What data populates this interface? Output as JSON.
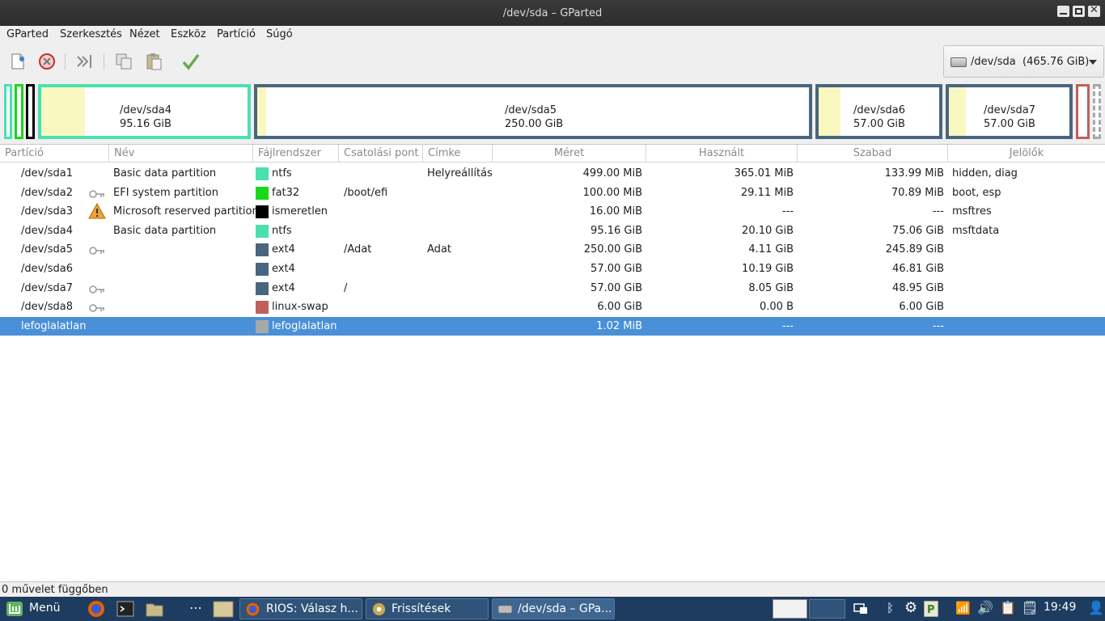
{
  "window": {
    "title": "/dev/sda – GParted"
  },
  "menu": [
    "GParted",
    "Szerkesztés",
    "Nézet",
    "Eszköz",
    "Partíció",
    "Súgó"
  ],
  "toolbar": {
    "icons": [
      "new-partition-icon",
      "delete-icon",
      "resize-move-icon",
      "copy-icon",
      "paste-icon",
      "apply-icon"
    ]
  },
  "device": {
    "name": "/dev/sda",
    "size": "(465.76 GiB)"
  },
  "map": [
    {
      "name": "/dev/sda4",
      "size": "95.16 GiB",
      "color": "#4ae0b0",
      "used": 0.21
    },
    {
      "name": "/dev/sda5",
      "size": "250.00 GiB",
      "color": "#4a6580",
      "used": 0.016
    },
    {
      "name": "/dev/sda6",
      "size": "57.00 GiB",
      "color": "#4a6580",
      "used": 0.18
    },
    {
      "name": "/dev/sda7",
      "size": "57.00 GiB",
      "color": "#4a6580",
      "used": 0.14
    }
  ],
  "columns": [
    "Partíció",
    "Név",
    "Fájlrendszer",
    "Csatolási pont",
    "Címke",
    "Méret",
    "Használt",
    "Szabad",
    "Jelölők"
  ],
  "rows": [
    {
      "partition": "/dev/sda1",
      "name": "Basic data partition",
      "fs": "ntfs",
      "fs_color": "#4ae0b0",
      "mount": "",
      "label": "Helyreállítás",
      "size": "499.00 MiB",
      "used": "365.01 MiB",
      "free": "133.99 MiB",
      "flags": "hidden, diag",
      "icon": ""
    },
    {
      "partition": "/dev/sda2",
      "name": "EFI system partition",
      "fs": "fat32",
      "fs_color": "#18d818",
      "mount": "/boot/efi",
      "label": "",
      "size": "100.00 MiB",
      "used": "29.11 MiB",
      "free": "70.89 MiB",
      "flags": "boot, esp",
      "icon": "key"
    },
    {
      "partition": "/dev/sda3",
      "name": "Microsoft reserved partition",
      "fs": "ismeretlen",
      "fs_color": "#000000",
      "mount": "",
      "label": "",
      "size": "16.00 MiB",
      "used": "---",
      "free": "---",
      "flags": "msftres",
      "icon": "warning"
    },
    {
      "partition": "/dev/sda4",
      "name": "Basic data partition",
      "fs": "ntfs",
      "fs_color": "#4ae0b0",
      "mount": "",
      "label": "",
      "size": "95.16 GiB",
      "used": "20.10 GiB",
      "free": "75.06 GiB",
      "flags": "msftdata",
      "icon": ""
    },
    {
      "partition": "/dev/sda5",
      "name": "",
      "fs": "ext4",
      "fs_color": "#4a6580",
      "mount": "/Adat",
      "label": "Adat",
      "size": "250.00 GiB",
      "used": "4.11 GiB",
      "free": "245.89 GiB",
      "flags": "",
      "icon": "key"
    },
    {
      "partition": "/dev/sda6",
      "name": "",
      "fs": "ext4",
      "fs_color": "#4a6580",
      "mount": "",
      "label": "",
      "size": "57.00 GiB",
      "used": "10.19 GiB",
      "free": "46.81 GiB",
      "flags": "",
      "icon": ""
    },
    {
      "partition": "/dev/sda7",
      "name": "",
      "fs": "ext4",
      "fs_color": "#4a6580",
      "mount": "/",
      "label": "",
      "size": "57.00 GiB",
      "used": "8.05 GiB",
      "free": "48.95 GiB",
      "flags": "",
      "icon": "key"
    },
    {
      "partition": "/dev/sda8",
      "name": "",
      "fs": "linux-swap",
      "fs_color": "#c0605a",
      "mount": "",
      "label": "",
      "size": "6.00 GiB",
      "used": "0.00 B",
      "free": "6.00 GiB",
      "flags": "",
      "icon": "key"
    },
    {
      "partition": "lefoglalatlan",
      "name": "",
      "fs": "lefoglalatlan",
      "fs_color": "#a8a8a8",
      "mount": "",
      "label": "",
      "size": "1.02 MiB",
      "used": "---",
      "free": "---",
      "flags": "",
      "icon": ""
    }
  ],
  "selected_row": 8,
  "status": "0 művelet függőben",
  "taskbar": {
    "menu_label": "Menü",
    "windows": [
      "RIOS: Válasz h...",
      "Frissítések",
      "/dev/sda – GPa..."
    ],
    "clock": "19:49"
  }
}
